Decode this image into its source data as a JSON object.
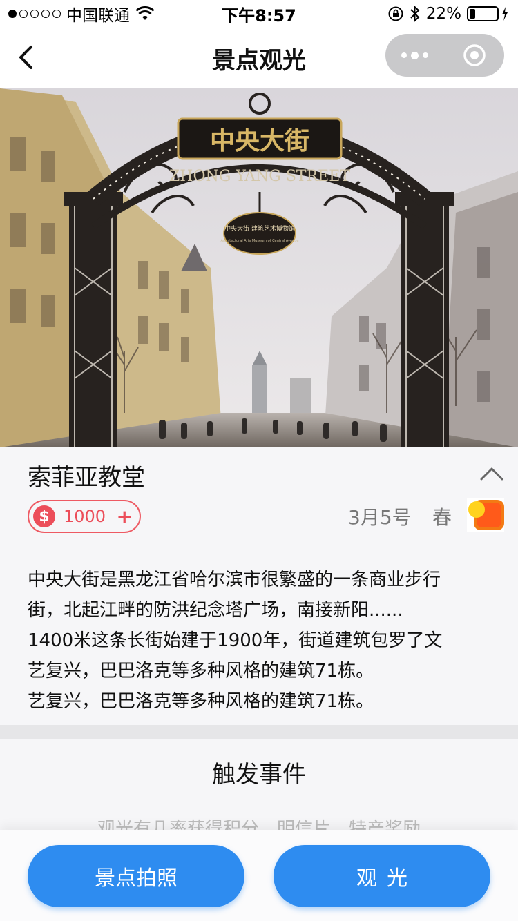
{
  "status_bar": {
    "carrier": "中国联通",
    "time": "下午8:57",
    "battery_percent": "22%",
    "battery_level": 0.22,
    "signal_dots_filled": 1,
    "signal_dots_total": 5
  },
  "nav": {
    "title": "景点观光"
  },
  "spot": {
    "name": "索菲亚教堂",
    "coins": "1000",
    "coin_symbol": "$",
    "plus": "+",
    "date": "3月5号",
    "season": "春",
    "description": [
      "中央大街是黑龙江省哈尔滨市很繁盛的一条商业步行",
      "街，北起江畔的防洪纪念塔广场，南接新阳......",
      "1400米这条长街始建于1900年，街道建筑包罗了文",
      "艺复兴，巴巴洛克等多种风格的建筑71栋。",
      "艺复兴，巴巴洛克等多种风格的建筑71栋。"
    ]
  },
  "hero_image": {
    "sign_cn": "中央大街",
    "sign_en": "ZHONG YANG STREET",
    "plaque_cn": "中央大街 建筑艺术博物馆",
    "plaque_en": "Architectural Arts Museum of Central Avenue"
  },
  "events": {
    "title": "触发事件",
    "subtitle": "观光有几率获得积分，明信片，特产奖励"
  },
  "actions": {
    "photo_label": "景点拍照",
    "sightsee_label": "观光"
  },
  "colors": {
    "primary_blue": "#2e8cf0",
    "coin_red": "#ec4e5a",
    "capsule_gray": "#c9c9cb"
  }
}
